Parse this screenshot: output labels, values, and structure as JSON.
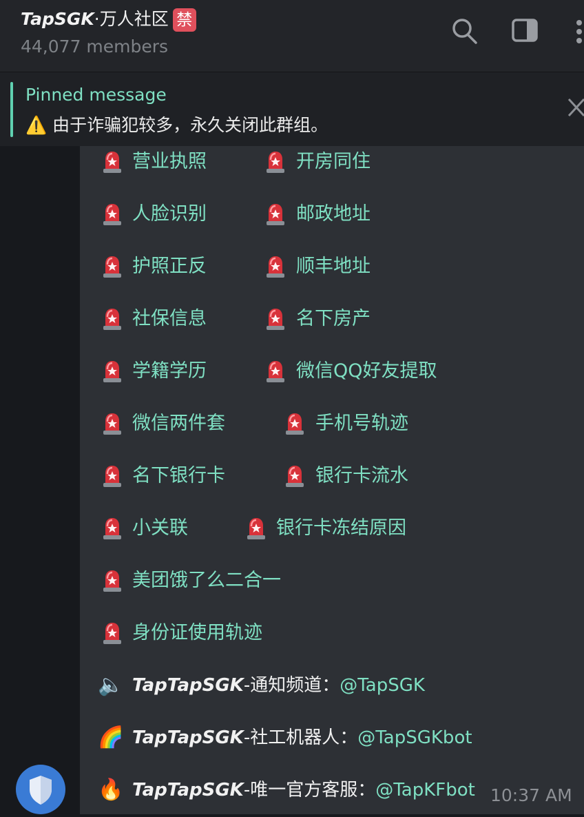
{
  "header": {
    "brand": "TapSGK",
    "title_rest": "·万人社区",
    "ban_badge": "禁",
    "members": "44,077 members"
  },
  "pinned": {
    "title": "Pinned message",
    "warning_emoji": "⚠️",
    "text": "由于诈骗犯较多，永久关闭此群组。"
  },
  "services": [
    "营业执照",
    "开房同住",
    "人脸识别",
    "邮政地址",
    "护照正反",
    "顺丰地址",
    "社保信息",
    "名下房产",
    "学籍学历",
    "微信QQ好友提取",
    "微信两件套",
    "手机号轨迹",
    "名下银行卡",
    "银行卡流水",
    "小关联",
    "银行卡冻结原因",
    "美团饿了么二合一",
    "身份证使用轨迹"
  ],
  "contacts": [
    {
      "emoji": "🔈",
      "name": "TapTapSGK",
      "label": "-通知频道：",
      "link": "@TapSGK"
    },
    {
      "emoji": "🌈",
      "name": "TapTapSGK",
      "label": "-社工机器人：",
      "link": "@TapSGKbot"
    },
    {
      "emoji": "🔥",
      "name": "TapTapSGK",
      "label": "-唯一官方客服：",
      "link": "@TapKFbot"
    }
  ],
  "message": {
    "time": "10:37 AM"
  },
  "colors": {
    "accent": "#7fe0c3",
    "badge": "#e0505c",
    "bubble": "#2d3035"
  }
}
